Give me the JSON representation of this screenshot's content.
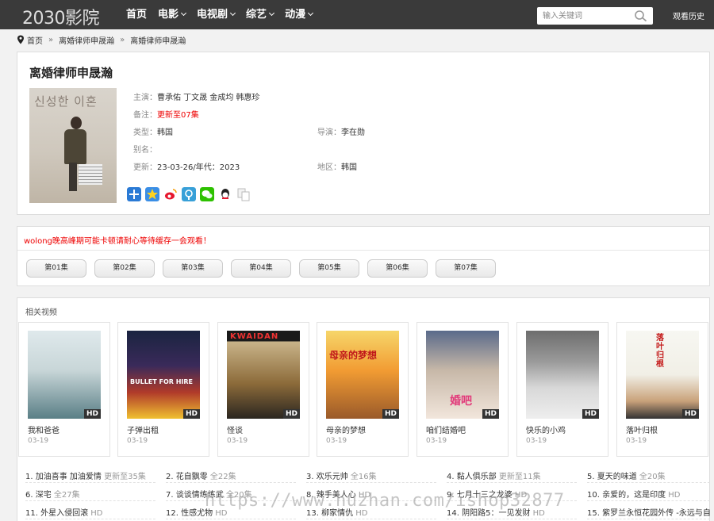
{
  "header": {
    "logo": "2030影院",
    "nav": [
      {
        "label": "首页",
        "dropdown": false
      },
      {
        "label": "电影",
        "dropdown": true
      },
      {
        "label": "电视剧",
        "dropdown": true
      },
      {
        "label": "综艺",
        "dropdown": true
      },
      {
        "label": "动漫",
        "dropdown": true
      }
    ],
    "search_placeholder": "输入关键词",
    "history_label": "观看历史"
  },
  "breadcrumb": {
    "home": "首页",
    "sep": "»",
    "category": "离婚律师申晟瀚",
    "current": "离婚律师申晟瀚"
  },
  "detail": {
    "title": "离婚律师申晟瀚",
    "poster_text": "신성한 이혼",
    "cast_label": "主演：",
    "cast": "曹承佑 丁文晟 金成均 韩惠珍",
    "note_label": "备注：",
    "note": "更新至07集",
    "type_label": "类型：",
    "type": "韩国",
    "director_label": "导演：",
    "director": "李在勋",
    "alias_label": "别名：",
    "alias": "",
    "update_label": "更新：",
    "update": "23-03-26/年代：2023",
    "region_label": "地区：",
    "region": "韩国"
  },
  "episodes": {
    "notice_prefix": "wolong",
    "notice": "晚高峰期可能卡顿请耐心等待缓存一会观看！",
    "items": [
      "第01集",
      "第02集",
      "第03集",
      "第04集",
      "第05集",
      "第06集",
      "第07集"
    ]
  },
  "related": {
    "title": "相关视频",
    "hd_badge": "HD",
    "items": [
      {
        "name": "我和爸爸",
        "date": "03-19"
      },
      {
        "name": "子弹出租",
        "date": "03-19"
      },
      {
        "name": "怪谈",
        "date": "03-19"
      },
      {
        "name": "母亲的梦想",
        "date": "03-19"
      },
      {
        "name": "咱们结婚吧",
        "date": "03-19"
      },
      {
        "name": "快乐的小鸡",
        "date": "03-19"
      },
      {
        "name": "落叶归根",
        "date": "03-19"
      }
    ],
    "thumb_text": [
      "",
      "BULLET FOR HIRE",
      "KWAIDAN",
      "母亲的梦想",
      "婚吧",
      "",
      "落叶归根"
    ],
    "list": [
      {
        "num": "1.",
        "name": "加油喜事 加油爱情",
        "status": "更新至35集"
      },
      {
        "num": "2.",
        "name": "花自飘零",
        "status": "全22集"
      },
      {
        "num": "3.",
        "name": "欢乐元帅",
        "status": "全16集"
      },
      {
        "num": "4.",
        "name": "黏人俱乐部",
        "status": "更新至11集"
      },
      {
        "num": "5.",
        "name": "夏天的味道",
        "status": "全20集"
      },
      {
        "num": "6.",
        "name": "深宅",
        "status": "全27集"
      },
      {
        "num": "7.",
        "name": "谈谈情练练武",
        "status": "全20集"
      },
      {
        "num": "8.",
        "name": "辣手美人心",
        "status": "HD"
      },
      {
        "num": "9.",
        "name": "七月十三之龙婆",
        "status": "HD"
      },
      {
        "num": "10.",
        "name": "亲爱的，这是印度",
        "status": "HD"
      },
      {
        "num": "11.",
        "name": "外星入侵回滚",
        "status": "HD"
      },
      {
        "num": "12.",
        "name": "性感尤物",
        "status": "HD"
      },
      {
        "num": "13.",
        "name": "柳家情仇",
        "status": "HD"
      },
      {
        "num": "14.",
        "name": "阴阳路5：一见发财",
        "status": "HD"
      },
      {
        "num": "15.",
        "name": "紫罗兰永恒花园外传 -永远与自动",
        "status": ""
      }
    ]
  },
  "watermark": "https://www.huzhan.com/ishop32877",
  "colors": {
    "header_bg": "#3a3a3a",
    "accent_red": "#ee0000",
    "page_bg": "#f2f2f2"
  }
}
